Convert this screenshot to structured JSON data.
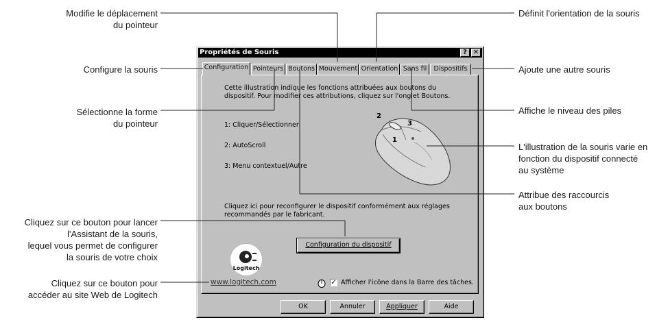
{
  "annotations": {
    "deplacement": "Modifie le déplacement\ndu pointeur",
    "orientation": "Définit l'orientation de la souris",
    "configure": "Configure la souris",
    "ajoute": "Ajoute une autre souris",
    "forme": "Sélectionne la forme\ndu pointeur",
    "piles": "Affiche le niveau des piles",
    "illustration": "L'illustration de la souris varie en\nfonction du dispositif connecté\nau système",
    "raccourcis": "Attribue des raccourcis\naux boutons",
    "assistant": "Cliquez sur ce bouton pour lancer\nl'Assistant de la souris,\nlequel vous permet de configurer\nla souris de votre choix",
    "site_web": "Cliquez sur ce bouton pour\naccéder au site Web de Logitech"
  },
  "dialog": {
    "title": "Propriétés de Souris",
    "help_btn": "?",
    "close_btn": "✕",
    "tabs": [
      "Configuration",
      "Pointeurs",
      "Boutons",
      "Mouvement",
      "Orientation",
      "Sans fil",
      "Dispositifs"
    ],
    "active_tab": "Configuration",
    "intro": "Cette illustration indique les fonctions attribuées aux boutons du\ndispositif.  Pour modifier ces attributions, cliquez sur l'onglet Boutons.",
    "button_functions": [
      "1:  Cliquer/Sélectionner",
      "2:  AutoScroll",
      "3:  Menu contextuel/Autre"
    ],
    "mouse_labels": [
      "2",
      "3",
      "1"
    ],
    "reconfigure_text": "Cliquez ici pour reconfigurer le dispositif conformément aux réglages\nrecommandés par le fabricant.",
    "config_button": "Configuration du dispositif",
    "logo_text": "Logitech",
    "website_link": "www.logitech.com",
    "taskbar_checkbox": "Afficher l'icône dans la Barre des tâches.",
    "taskbar_checked": true,
    "footer_buttons": {
      "ok": "OK",
      "cancel": "Annuler",
      "apply": "Appliquer",
      "help": "Aide"
    }
  }
}
